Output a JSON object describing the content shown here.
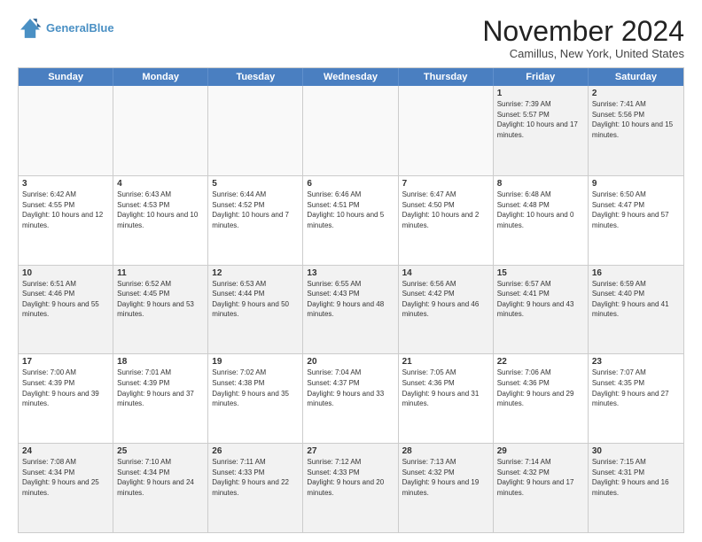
{
  "logo": {
    "line1": "General",
    "line2": "Blue"
  },
  "title": "November 2024",
  "location": "Camillus, New York, United States",
  "days_of_week": [
    "Sunday",
    "Monday",
    "Tuesday",
    "Wednesday",
    "Thursday",
    "Friday",
    "Saturday"
  ],
  "rows": [
    [
      {
        "day": "",
        "info": ""
      },
      {
        "day": "",
        "info": ""
      },
      {
        "day": "",
        "info": ""
      },
      {
        "day": "",
        "info": ""
      },
      {
        "day": "",
        "info": ""
      },
      {
        "day": "1",
        "info": "Sunrise: 7:39 AM\nSunset: 5:57 PM\nDaylight: 10 hours and 17 minutes."
      },
      {
        "day": "2",
        "info": "Sunrise: 7:41 AM\nSunset: 5:56 PM\nDaylight: 10 hours and 15 minutes."
      }
    ],
    [
      {
        "day": "3",
        "info": "Sunrise: 6:42 AM\nSunset: 4:55 PM\nDaylight: 10 hours and 12 minutes."
      },
      {
        "day": "4",
        "info": "Sunrise: 6:43 AM\nSunset: 4:53 PM\nDaylight: 10 hours and 10 minutes."
      },
      {
        "day": "5",
        "info": "Sunrise: 6:44 AM\nSunset: 4:52 PM\nDaylight: 10 hours and 7 minutes."
      },
      {
        "day": "6",
        "info": "Sunrise: 6:46 AM\nSunset: 4:51 PM\nDaylight: 10 hours and 5 minutes."
      },
      {
        "day": "7",
        "info": "Sunrise: 6:47 AM\nSunset: 4:50 PM\nDaylight: 10 hours and 2 minutes."
      },
      {
        "day": "8",
        "info": "Sunrise: 6:48 AM\nSunset: 4:48 PM\nDaylight: 10 hours and 0 minutes."
      },
      {
        "day": "9",
        "info": "Sunrise: 6:50 AM\nSunset: 4:47 PM\nDaylight: 9 hours and 57 minutes."
      }
    ],
    [
      {
        "day": "10",
        "info": "Sunrise: 6:51 AM\nSunset: 4:46 PM\nDaylight: 9 hours and 55 minutes."
      },
      {
        "day": "11",
        "info": "Sunrise: 6:52 AM\nSunset: 4:45 PM\nDaylight: 9 hours and 53 minutes."
      },
      {
        "day": "12",
        "info": "Sunrise: 6:53 AM\nSunset: 4:44 PM\nDaylight: 9 hours and 50 minutes."
      },
      {
        "day": "13",
        "info": "Sunrise: 6:55 AM\nSunset: 4:43 PM\nDaylight: 9 hours and 48 minutes."
      },
      {
        "day": "14",
        "info": "Sunrise: 6:56 AM\nSunset: 4:42 PM\nDaylight: 9 hours and 46 minutes."
      },
      {
        "day": "15",
        "info": "Sunrise: 6:57 AM\nSunset: 4:41 PM\nDaylight: 9 hours and 43 minutes."
      },
      {
        "day": "16",
        "info": "Sunrise: 6:59 AM\nSunset: 4:40 PM\nDaylight: 9 hours and 41 minutes."
      }
    ],
    [
      {
        "day": "17",
        "info": "Sunrise: 7:00 AM\nSunset: 4:39 PM\nDaylight: 9 hours and 39 minutes."
      },
      {
        "day": "18",
        "info": "Sunrise: 7:01 AM\nSunset: 4:39 PM\nDaylight: 9 hours and 37 minutes."
      },
      {
        "day": "19",
        "info": "Sunrise: 7:02 AM\nSunset: 4:38 PM\nDaylight: 9 hours and 35 minutes."
      },
      {
        "day": "20",
        "info": "Sunrise: 7:04 AM\nSunset: 4:37 PM\nDaylight: 9 hours and 33 minutes."
      },
      {
        "day": "21",
        "info": "Sunrise: 7:05 AM\nSunset: 4:36 PM\nDaylight: 9 hours and 31 minutes."
      },
      {
        "day": "22",
        "info": "Sunrise: 7:06 AM\nSunset: 4:36 PM\nDaylight: 9 hours and 29 minutes."
      },
      {
        "day": "23",
        "info": "Sunrise: 7:07 AM\nSunset: 4:35 PM\nDaylight: 9 hours and 27 minutes."
      }
    ],
    [
      {
        "day": "24",
        "info": "Sunrise: 7:08 AM\nSunset: 4:34 PM\nDaylight: 9 hours and 25 minutes."
      },
      {
        "day": "25",
        "info": "Sunrise: 7:10 AM\nSunset: 4:34 PM\nDaylight: 9 hours and 24 minutes."
      },
      {
        "day": "26",
        "info": "Sunrise: 7:11 AM\nSunset: 4:33 PM\nDaylight: 9 hours and 22 minutes."
      },
      {
        "day": "27",
        "info": "Sunrise: 7:12 AM\nSunset: 4:33 PM\nDaylight: 9 hours and 20 minutes."
      },
      {
        "day": "28",
        "info": "Sunrise: 7:13 AM\nSunset: 4:32 PM\nDaylight: 9 hours and 19 minutes."
      },
      {
        "day": "29",
        "info": "Sunrise: 7:14 AM\nSunset: 4:32 PM\nDaylight: 9 hours and 17 minutes."
      },
      {
        "day": "30",
        "info": "Sunrise: 7:15 AM\nSunset: 4:31 PM\nDaylight: 9 hours and 16 minutes."
      }
    ]
  ]
}
